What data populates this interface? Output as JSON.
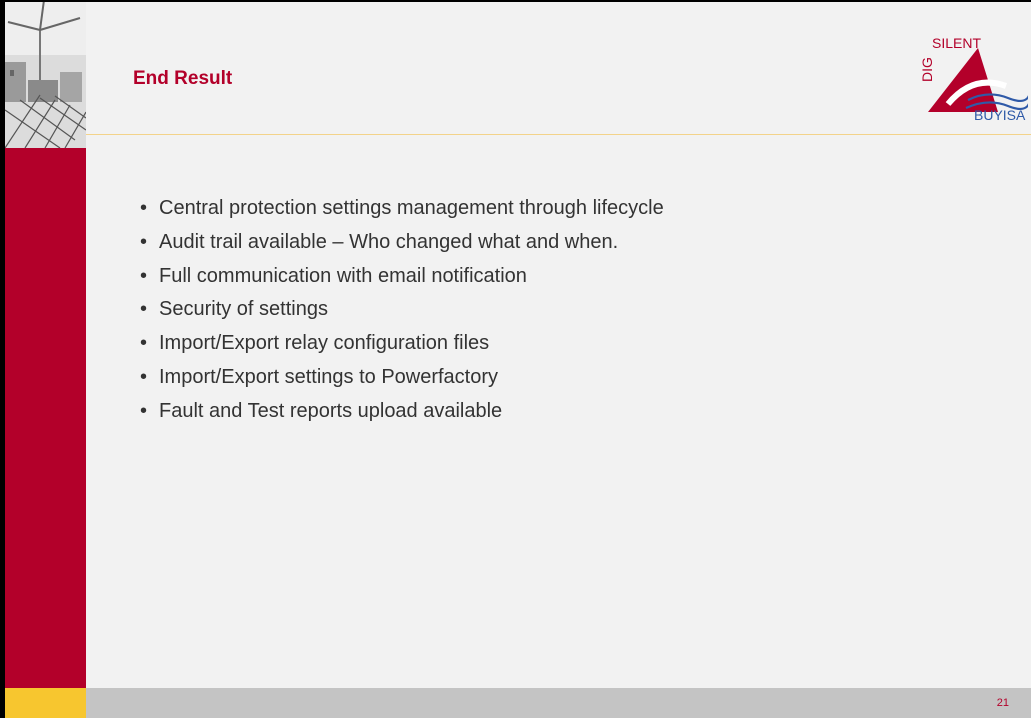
{
  "slide": {
    "title": "End Result",
    "page_number": "21",
    "bullets": [
      "Central protection settings management through lifecycle",
      "Audit trail available – Who changed what and when.",
      "Full communication with email notification",
      "Security of settings",
      "Import/Export relay configuration files",
      "Import/Export settings to Powerfactory",
      "Fault and Test reports upload available"
    ],
    "bullet_glyph": "•"
  },
  "logo": {
    "top_word": "SILENT",
    "vertical_word": "DIG",
    "bottom_word": "BUYISA"
  },
  "colors": {
    "accent_red": "#b3002a",
    "accent_yellow": "#f7c62f",
    "footer_gray": "#c4c4c4",
    "background": "#f2f2f2",
    "text": "#333333"
  }
}
